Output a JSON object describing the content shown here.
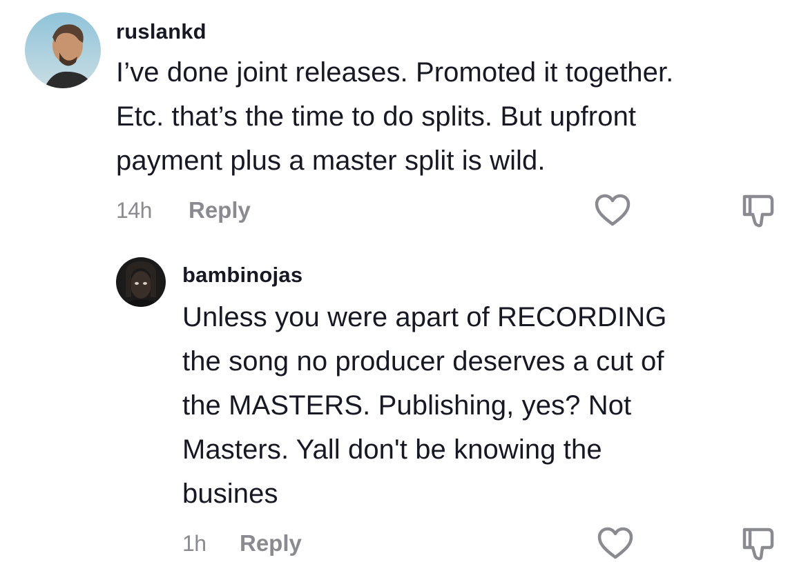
{
  "comments": [
    {
      "username": "ruslankd",
      "lines": [
        "I’ve done joint releases. Promoted it together.",
        "Etc. that’s the time to do splits. But upfront",
        "payment plus a master split is wild."
      ],
      "time": "14h",
      "reply_label": "Reply"
    },
    {
      "username": "bambinojas",
      "lines": [
        "Unless you were apart of RECORDING",
        "the song no producer deserves a cut of",
        "the MASTERS. Publishing, yes? Not",
        "Masters. Yall don't be knowing the",
        "busines"
      ],
      "time": "1h",
      "reply_label": "Reply"
    }
  ],
  "colors": {
    "text": "#161823",
    "muted": "#8a8b91",
    "icon": "#8a8b91"
  },
  "icons": {
    "like": "heart-icon",
    "dislike": "thumbs-down-icon"
  }
}
